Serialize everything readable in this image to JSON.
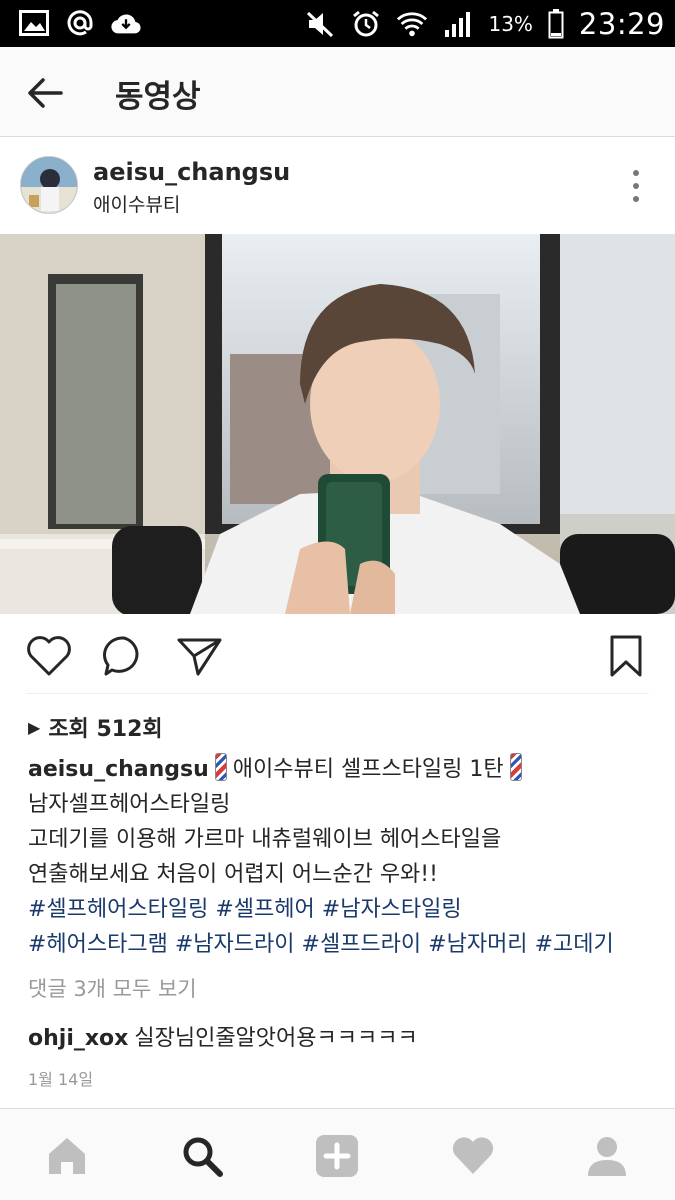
{
  "status_bar": {
    "battery_percent": "13%",
    "time": "23:29",
    "left_icons": [
      "image-icon",
      "at-icon",
      "cloud-download-icon"
    ],
    "right_icons": [
      "mute-icon",
      "alarm-icon",
      "wifi-icon",
      "signal-icon",
      "battery-icon"
    ]
  },
  "app_bar": {
    "title": "동영상"
  },
  "post": {
    "username": "aeisu_changsu",
    "location": "애이수뷰티",
    "views_label": "조회 512회",
    "caption_user": "aeisu_changsu",
    "caption_line1": "애이수뷰티 셀프스타일링 1탄",
    "caption_line2": "남자셀프헤어스타일링",
    "caption_line3": "고데기를 이용해 가르마 내츄럴웨이브 헤어스타일을",
    "caption_line4": "연출해보세요 처음이 어렵지 어느순간 우와!!",
    "hashtags_line1": [
      "#셀프헤어스타일링",
      "#셀프헤어",
      "#남자스타일링"
    ],
    "hashtags_line2": [
      "#헤어스타그램",
      "#남자드라이",
      "#셀프드라이",
      "#남자머리",
      "#고데기"
    ],
    "view_all_comments": "댓글 3개 모두 보기",
    "comment_user": "ohji_xox",
    "comment_text": "실장님인줄알앗어용ㅋㅋㅋㅋㅋ",
    "date": "1월 14일"
  },
  "colors": {
    "hashtag": "#1a3a6b",
    "muted": "#999999",
    "status_bar_bg": "#000000",
    "app_bar_bg": "#fafafa"
  },
  "bottom_nav": [
    "home-icon",
    "search-icon",
    "add-icon",
    "heart-icon",
    "profile-icon"
  ]
}
